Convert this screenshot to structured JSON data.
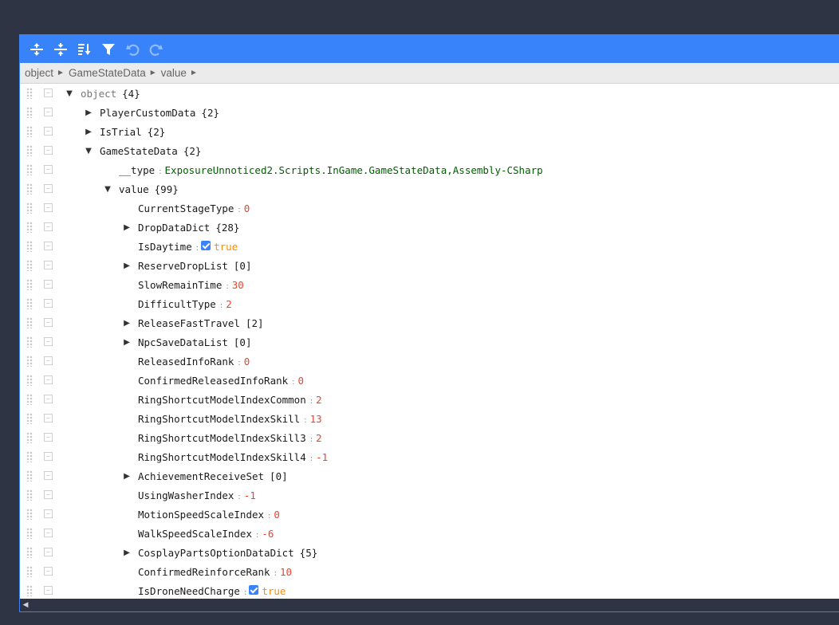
{
  "toolbar": {
    "expand_all": "expand-all",
    "collapse_all": "collapse-all",
    "sort": "sort",
    "filter": "filter",
    "undo": "undo",
    "redo": "redo"
  },
  "breadcrumb": [
    "object",
    "GameStateData",
    "value"
  ],
  "breadcrumb_sep": "►",
  "tree": [
    {
      "depth": 0,
      "expander": "▼",
      "field": "object",
      "count": "{4}",
      "root": true
    },
    {
      "depth": 1,
      "expander": "▶",
      "field": "PlayerCustomData",
      "count": "{2}"
    },
    {
      "depth": 1,
      "expander": "▶",
      "field": "IsTrial",
      "count": "{2}"
    },
    {
      "depth": 1,
      "expander": "▼",
      "field": "GameStateData",
      "count": "{2}"
    },
    {
      "depth": 2,
      "field": "__type",
      "value": "ExposureUnnoticed2.Scripts.InGame.GameStateData,Assembly-CSharp",
      "vtype": "str"
    },
    {
      "depth": 2,
      "expander": "▼",
      "field": "value",
      "count": "{99}"
    },
    {
      "depth": 3,
      "field": "CurrentStageType",
      "value": "0",
      "vtype": "num"
    },
    {
      "depth": 3,
      "expander": "▶",
      "field": "DropDataDict",
      "count": "{28}"
    },
    {
      "depth": 3,
      "field": "IsDaytime",
      "value": "true",
      "vtype": "bool"
    },
    {
      "depth": 3,
      "expander": "▶",
      "field": "ReserveDropList",
      "count": "[0]"
    },
    {
      "depth": 3,
      "field": "SlowRemainTime",
      "value": "30",
      "vtype": "num"
    },
    {
      "depth": 3,
      "field": "DifficultType",
      "value": "2",
      "vtype": "num"
    },
    {
      "depth": 3,
      "expander": "▶",
      "field": "ReleaseFastTravel",
      "count": "[2]"
    },
    {
      "depth": 3,
      "expander": "▶",
      "field": "NpcSaveDataList",
      "count": "[0]"
    },
    {
      "depth": 3,
      "field": "ReleasedInfoRank",
      "value": "0",
      "vtype": "num"
    },
    {
      "depth": 3,
      "field": "ConfirmedReleasedInfoRank",
      "value": "0",
      "vtype": "num"
    },
    {
      "depth": 3,
      "field": "RingShortcutModelIndexCommon",
      "value": "2",
      "vtype": "num"
    },
    {
      "depth": 3,
      "field": "RingShortcutModelIndexSkill",
      "value": "13",
      "vtype": "num"
    },
    {
      "depth": 3,
      "field": "RingShortcutModelIndexSkill3",
      "value": "2",
      "vtype": "num"
    },
    {
      "depth": 3,
      "field": "RingShortcutModelIndexSkill4",
      "value": "-1",
      "vtype": "num"
    },
    {
      "depth": 3,
      "expander": "▶",
      "field": "AchievementReceiveSet",
      "count": "[0]"
    },
    {
      "depth": 3,
      "field": "UsingWasherIndex",
      "value": "-1",
      "vtype": "num"
    },
    {
      "depth": 3,
      "field": "MotionSpeedScaleIndex",
      "value": "0",
      "vtype": "num"
    },
    {
      "depth": 3,
      "field": "WalkSpeedScaleIndex",
      "value": "-6",
      "vtype": "num"
    },
    {
      "depth": 3,
      "expander": "▶",
      "field": "CosplayPartsOptionDataDict",
      "count": "{5}"
    },
    {
      "depth": 3,
      "field": "ConfirmedReinforceRank",
      "value": "10",
      "vtype": "num"
    },
    {
      "depth": 3,
      "field": "IsDroneNeedCharge",
      "value": "true",
      "vtype": "bool"
    }
  ],
  "colors": {
    "accent": "#3883fa",
    "number": "#ee422e",
    "string": "#006000",
    "boolean": "#ff8c00",
    "background": "#2e3443"
  }
}
